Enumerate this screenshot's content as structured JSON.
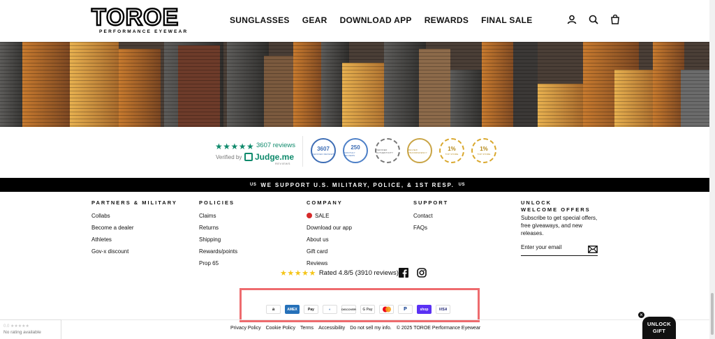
{
  "header": {
    "logo_text": "TOROE",
    "logo_tagline": "PERFORMANCE EYEWEAR",
    "nav": [
      "SUNGLASSES",
      "GEAR",
      "DOWNLOAD APP",
      "REWARDS",
      "FINAL SALE"
    ],
    "icons": [
      "account-icon",
      "search-icon",
      "cart-icon"
    ]
  },
  "reviews_widget": {
    "stars": "★★★★★",
    "count_text": "3607 reviews",
    "verified_text": "Verified by",
    "provider": "Judge.me",
    "provider_sub": "REVIEWS"
  },
  "badges": [
    {
      "num": "3607",
      "label": "VERIFIED REVIEWS"
    },
    {
      "num": "250",
      "label": "MONTHLY REVIEWS"
    },
    {
      "num": "",
      "label": "VERIFIED AUTHENTICITY"
    },
    {
      "num": "",
      "label": "REVIEW TRANSPARENCY"
    },
    {
      "num": "1%",
      "label": "TOP STORE"
    },
    {
      "num": "1%",
      "label": "TOP STORE"
    }
  ],
  "support_banner": {
    "prefix": "US",
    "text": "WE SUPPORT U.S. MILITARY, POLICE, & 1ST RESP.",
    "suffix": "US"
  },
  "footer": {
    "columns": [
      {
        "title": "PARTNERS & MILITARY",
        "links": [
          "Collabs",
          "Become a dealer",
          "Athletes",
          "Gov-x discount"
        ]
      },
      {
        "title": "POLICIES",
        "links": [
          "Claims",
          "Returns",
          "Shipping",
          "Rewards/points",
          "Prop 65"
        ]
      },
      {
        "title": "COMPANY",
        "links": [
          "SALE",
          "Download our app",
          "About us",
          "Gift card",
          "Reviews"
        ]
      },
      {
        "title": "SUPPORT",
        "links": [
          "Contact",
          "FAQs"
        ]
      }
    ],
    "welcome": {
      "title": "UNLOCK WELCOME OFFERS",
      "text": "Subscribe to get special offers, free giveaways, and new releases.",
      "email_placeholder": "Enter your email"
    }
  },
  "rated": {
    "stars": "★★★★★",
    "text": "Rated 4.8/5 (3910 reviews)"
  },
  "payments": [
    "amazon",
    "AMEX",
    "Pay",
    "D",
    "DISCOVER",
    "G Pay",
    "MC",
    "P",
    "shop",
    "VISA"
  ],
  "legal": {
    "links": [
      "Privacy Policy",
      "Cookie Policy",
      "Terms",
      "Accessibility",
      "Do not sell my info."
    ],
    "copyright": "© 2025 TOROE Performance Eyewear"
  },
  "rating_widget": {
    "stars": "0.0 ★★★★★",
    "text": "No rating available"
  },
  "unlock_gift": {
    "label_line1": "UNLOCK",
    "label_line2": "GIFT",
    "close": "×"
  },
  "colors": {
    "judgeme_green": "#0f8a6c",
    "highlight_box": "#ee6b6e",
    "sale_dot": "#d62b2b",
    "star_yellow": "#f5c518"
  }
}
